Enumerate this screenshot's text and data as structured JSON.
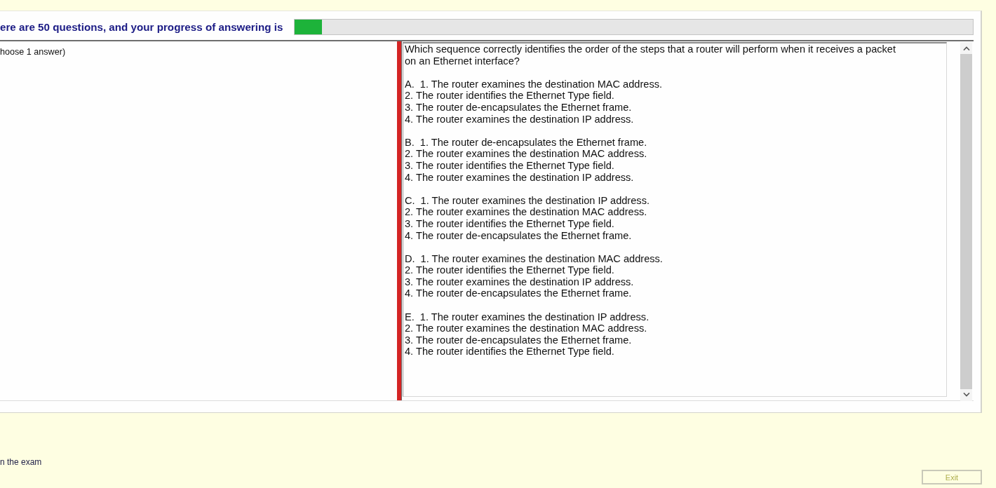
{
  "header": {
    "text": "ere are 50 questions, and your progress of answering is"
  },
  "progress": {
    "level": 0.04
  },
  "instruction": "hoose 1 answer)",
  "question": {
    "text": "Which sequence correctly identifies the order of the steps that a router will perform when it receives a packet on an Ethernet interface?",
    "options": [
      {
        "letter": "A.",
        "steps": [
          "1. The router examines the destination MAC address.",
          "2. The router identifies the Ethernet Type field.",
          "3. The router de-encapsulates the Ethernet frame.",
          "4. The router examines the destination IP address."
        ]
      },
      {
        "letter": "B.",
        "steps": [
          "1. The router de-encapsulates the Ethernet frame.",
          "2. The router examines the destination MAC address.",
          "3. The router identifies the Ethernet Type field.",
          "4. The router examines the destination IP address."
        ]
      },
      {
        "letter": "C.",
        "steps": [
          "1. The router examines the destination IP address.",
          "2. The router examines the destination MAC address.",
          "3. The router identifies the Ethernet Type field.",
          "4. The router de-encapsulates the Ethernet frame."
        ]
      },
      {
        "letter": "D.",
        "steps": [
          "1. The router examines the destination MAC address.",
          "2. The router identifies the Ethernet Type field.",
          "3. The router examines the destination IP address.",
          "4. The router de-encapsulates the Ethernet frame."
        ]
      },
      {
        "letter": "E.",
        "steps": [
          "1. The router examines the destination IP address.",
          "2. The router examines the destination MAC address.",
          "3. The router de-encapsulates the Ethernet frame.",
          "4. The router identifies the Ethernet Type field."
        ]
      }
    ]
  },
  "footer": {
    "text": "n the exam"
  },
  "exit_button": {
    "label": "Exit",
    "disabled": true
  }
}
